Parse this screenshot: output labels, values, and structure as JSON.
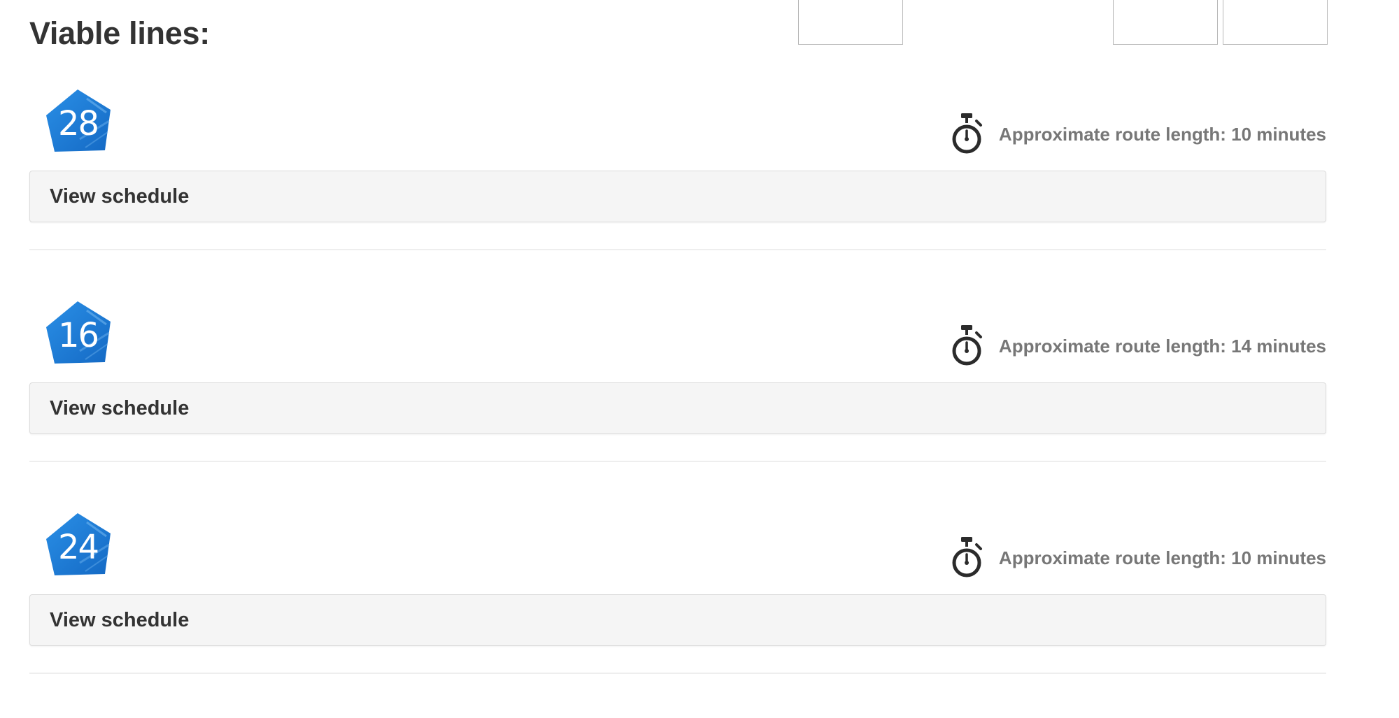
{
  "page": {
    "heading": "Viable lines:"
  },
  "colors": {
    "badge_blue": "#1f7fd6",
    "text_dark": "#333333",
    "text_muted": "#777777",
    "button_bg": "#f5f5f5"
  },
  "lines": [
    {
      "number": "28",
      "duration_label": "Approximate route length: 10 minutes",
      "duration_minutes": 10,
      "schedule_label": "View schedule",
      "icon": "stopwatch-icon"
    },
    {
      "number": "16",
      "duration_label": "Approximate route length: 14 minutes",
      "duration_minutes": 14,
      "schedule_label": "View schedule",
      "icon": "stopwatch-icon"
    },
    {
      "number": "24",
      "duration_label": "Approximate route length: 10 minutes",
      "duration_minutes": 10,
      "schedule_label": "View schedule",
      "icon": "stopwatch-icon"
    }
  ]
}
